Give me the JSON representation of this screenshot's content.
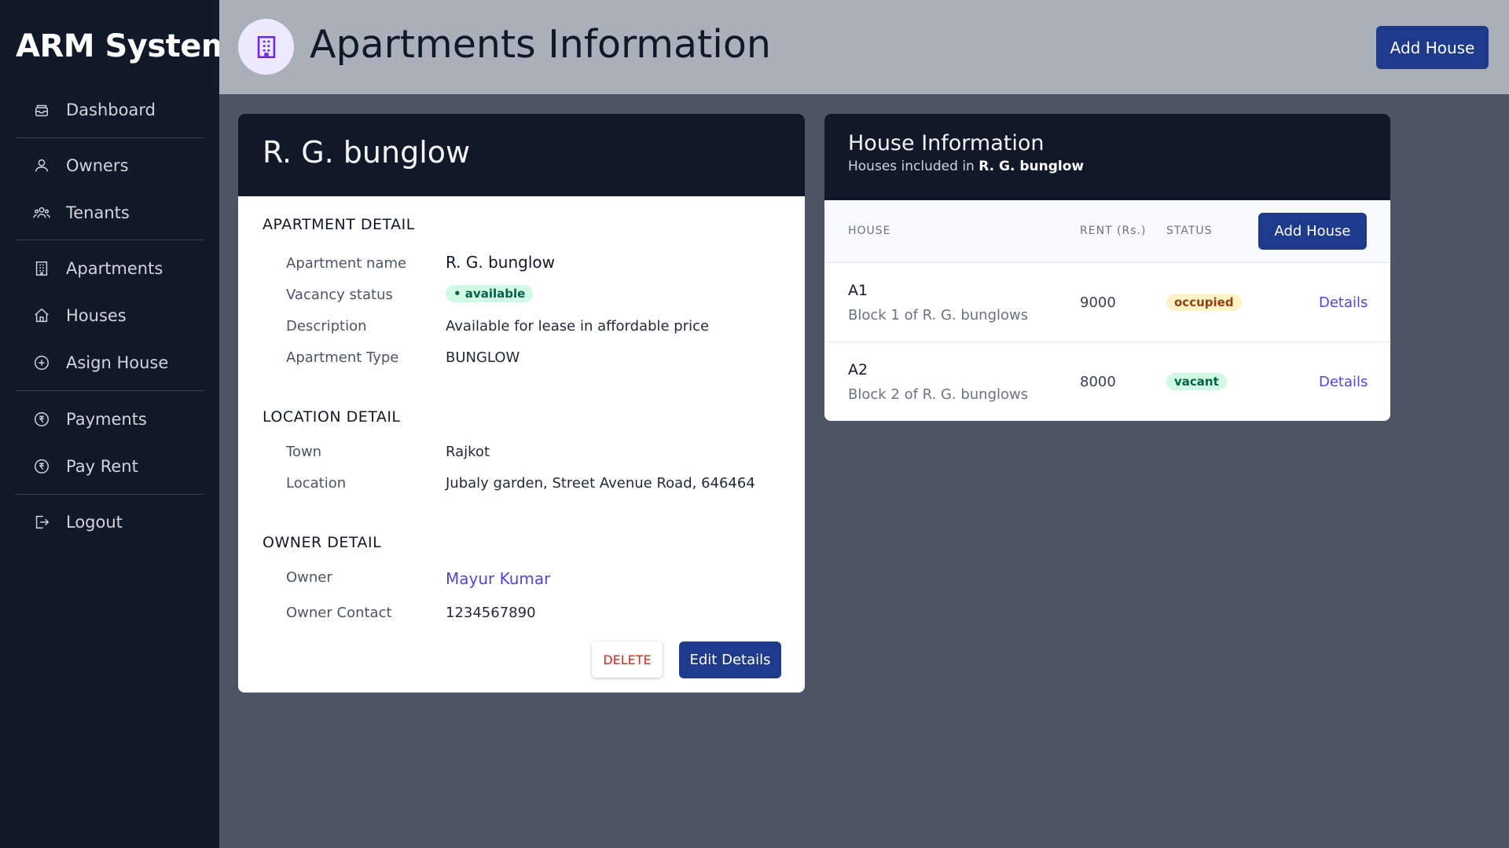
{
  "sidebar": {
    "brand": "ARM System",
    "items": [
      {
        "label": "Dashboard",
        "icon": "inbox-icon"
      },
      {
        "label": "Owners",
        "icon": "user-icon"
      },
      {
        "label": "Tenants",
        "icon": "users-icon"
      },
      {
        "label": "Apartments",
        "icon": "building-icon"
      },
      {
        "label": "Houses",
        "icon": "home-icon"
      },
      {
        "label": "Asign House",
        "icon": "plus-circle-icon"
      },
      {
        "label": "Payments",
        "icon": "rupee-icon"
      },
      {
        "label": "Pay Rent",
        "icon": "rupee-icon"
      },
      {
        "label": "Logout",
        "icon": "logout-icon"
      }
    ]
  },
  "header": {
    "title": "Apartments Information",
    "icon": "building-icon",
    "add_button": "Add House"
  },
  "apartment": {
    "name": "R. G. bunglow",
    "sections": {
      "apartment_detail": "APARTMENT DETAIL",
      "location_detail": "LOCATION DETAIL",
      "owner_detail": "OWNER DETAIL"
    },
    "fields": {
      "name_label": "Apartment name",
      "name_value": "R. G. bunglow",
      "vacancy_label": "Vacancy status",
      "vacancy_value": "• available",
      "description_label": "Description",
      "description_value": "Available for lease in affordable price",
      "type_label": "Apartment Type",
      "type_value": "BUNGLOW",
      "town_label": "Town",
      "town_value": "Rajkot",
      "location_label": "Location",
      "location_value": "Jubaly garden, Street Avenue Road, 646464",
      "owner_label": "Owner",
      "owner_value": "Mayur Kumar",
      "contact_label": "Owner Contact",
      "contact_value": "1234567890"
    },
    "delete_button": "DELETE",
    "edit_button": "Edit Details"
  },
  "houses": {
    "title": "House Information",
    "subtitle_prefix": "Houses included in",
    "subtitle_apartment": "R. G. bunglow",
    "columns": {
      "house": "HOUSE",
      "rent": "RENT (Rs.)",
      "status": "STATUS"
    },
    "add_button": "Add House",
    "rows": [
      {
        "name": "A1",
        "desc": "Block 1 of R. G. bunglows",
        "rent": "9000",
        "status": "occupied",
        "link": "Details"
      },
      {
        "name": "A2",
        "desc": "Block 2 of R. G. bunglows",
        "rent": "8000",
        "status": "vacant",
        "link": "Details"
      }
    ],
    "status_colors": {
      "occupied": "#92400e",
      "vacant": "#065f46"
    }
  }
}
